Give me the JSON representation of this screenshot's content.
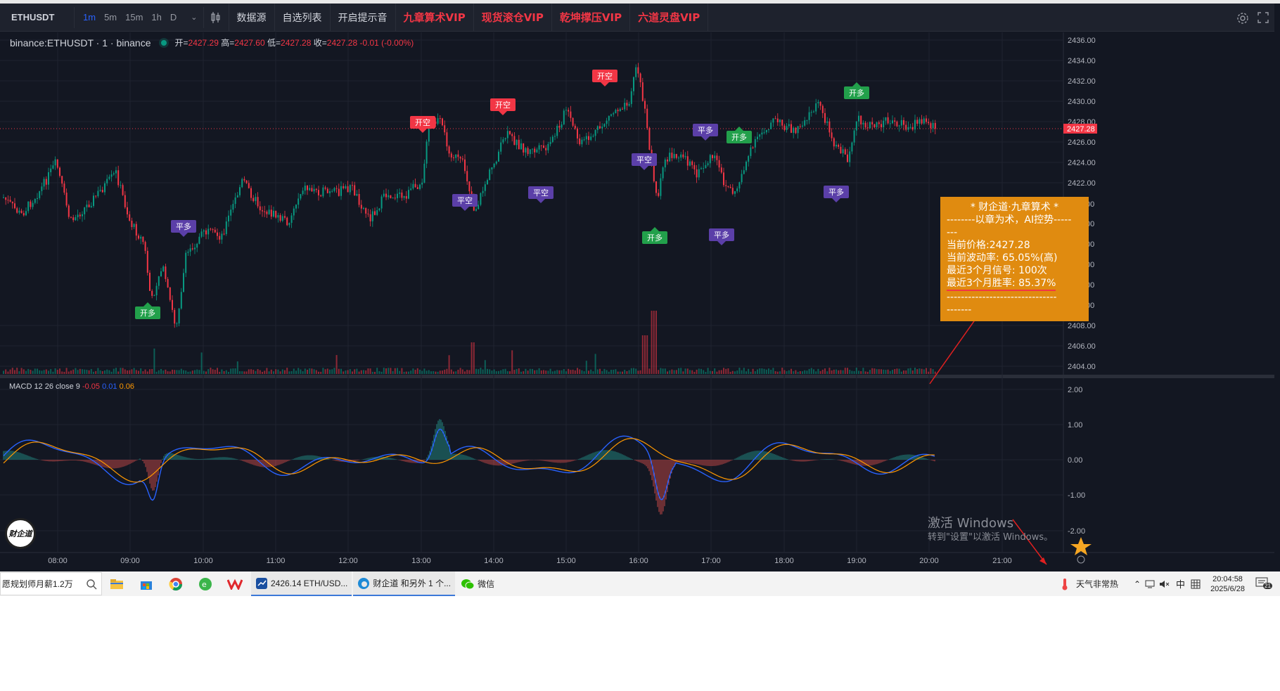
{
  "toolbar": {
    "symbol": "ETHUSDT",
    "intervals": [
      "1m",
      "5m",
      "15m",
      "1h",
      "D"
    ],
    "active_interval": "1m",
    "buttons": [
      "数据源",
      "自选列表",
      "开启提示音"
    ],
    "vip_buttons": [
      "九章算术VIP",
      "现货滚仓VIP",
      "乾坤撑压VIP",
      "六道灵盘VIP"
    ]
  },
  "legend": {
    "name": "binance:ETHUSDT · 1 · binance",
    "open_label": "开=",
    "open": "2427.29",
    "high_label": "高=",
    "high": "2427.60",
    "low_label": "低=",
    "low": "2427.28",
    "close_label": "收=",
    "close": "2427.28",
    "change": "-0.01 (-0.00%)"
  },
  "macd_legend": {
    "label": "MACD 12 26 close 9",
    "macd": "-0.05",
    "signal": "0.01",
    "hist": "0.06"
  },
  "price_axis": [
    "2436.00",
    "2434.00",
    "2432.00",
    "2430.00",
    "2428.00",
    "2426.00",
    "2424.00",
    "2422.00",
    "2408.00",
    "2406.00",
    "2404.00"
  ],
  "price_axis_partial": [
    "00",
    "00",
    "00",
    "00",
    "00",
    "00"
  ],
  "current_price_tag": "2427.28",
  "macd_axis": [
    "2.00",
    "1.00",
    "0.00",
    "-1.00",
    "-2.00"
  ],
  "time_axis": [
    "08:00",
    "09:00",
    "10:00",
    "11:00",
    "12:00",
    "13:00",
    "14:00",
    "15:00",
    "16:00",
    "17:00",
    "18:00",
    "19:00",
    "20:00",
    "21:00"
  ],
  "signals": [
    {
      "label": "开多",
      "type": "long"
    },
    {
      "label": "平多",
      "type": "close"
    },
    {
      "label": "开空",
      "type": "short"
    },
    {
      "label": "平空",
      "type": "close"
    },
    {
      "label": "开空",
      "type": "short"
    },
    {
      "label": "平空",
      "type": "close"
    },
    {
      "label": "开空",
      "type": "short"
    },
    {
      "label": "平空",
      "type": "close"
    },
    {
      "label": "开多",
      "type": "long"
    },
    {
      "label": "平多",
      "type": "close"
    },
    {
      "label": "平多",
      "type": "close"
    },
    {
      "label": "开多",
      "type": "long"
    },
    {
      "label": "平多",
      "type": "close"
    },
    {
      "label": "开多",
      "type": "long"
    }
  ],
  "infobox": {
    "title": "* 财企道·九章算术 *",
    "subtitle": "--------以章为术，AI控势-----",
    "dashes1": "---",
    "price": "当前价格:2427.28",
    "volatility": "当前波动率: 65.05%(高)",
    "signals": "最近3个月信号: 100次",
    "winrate": "最近3个月胜率: 85.37%",
    "dashes2": "-------------------------------",
    "dashes3": "-------"
  },
  "watermark": {
    "line1": "激活 Windows",
    "line2": "转到\"设置\"以激活 Windows。"
  },
  "logo_text": "财企道",
  "taskbar": {
    "search": "愿规划师月薪1.2万",
    "app1": "2426.14 ETH/USD...",
    "app2": "财企道 和另外 1 个...",
    "app3": "微信",
    "weather": "天气非常热",
    "ime": "中",
    "time": "20:04:58",
    "date": "2025/6/28",
    "notif_count": "21"
  },
  "colors": {
    "up": "#089981",
    "down": "#f23645",
    "vip": "#f23645",
    "box": "#e08b10",
    "macd": "#2962ff",
    "signal": "#ff9800"
  }
}
